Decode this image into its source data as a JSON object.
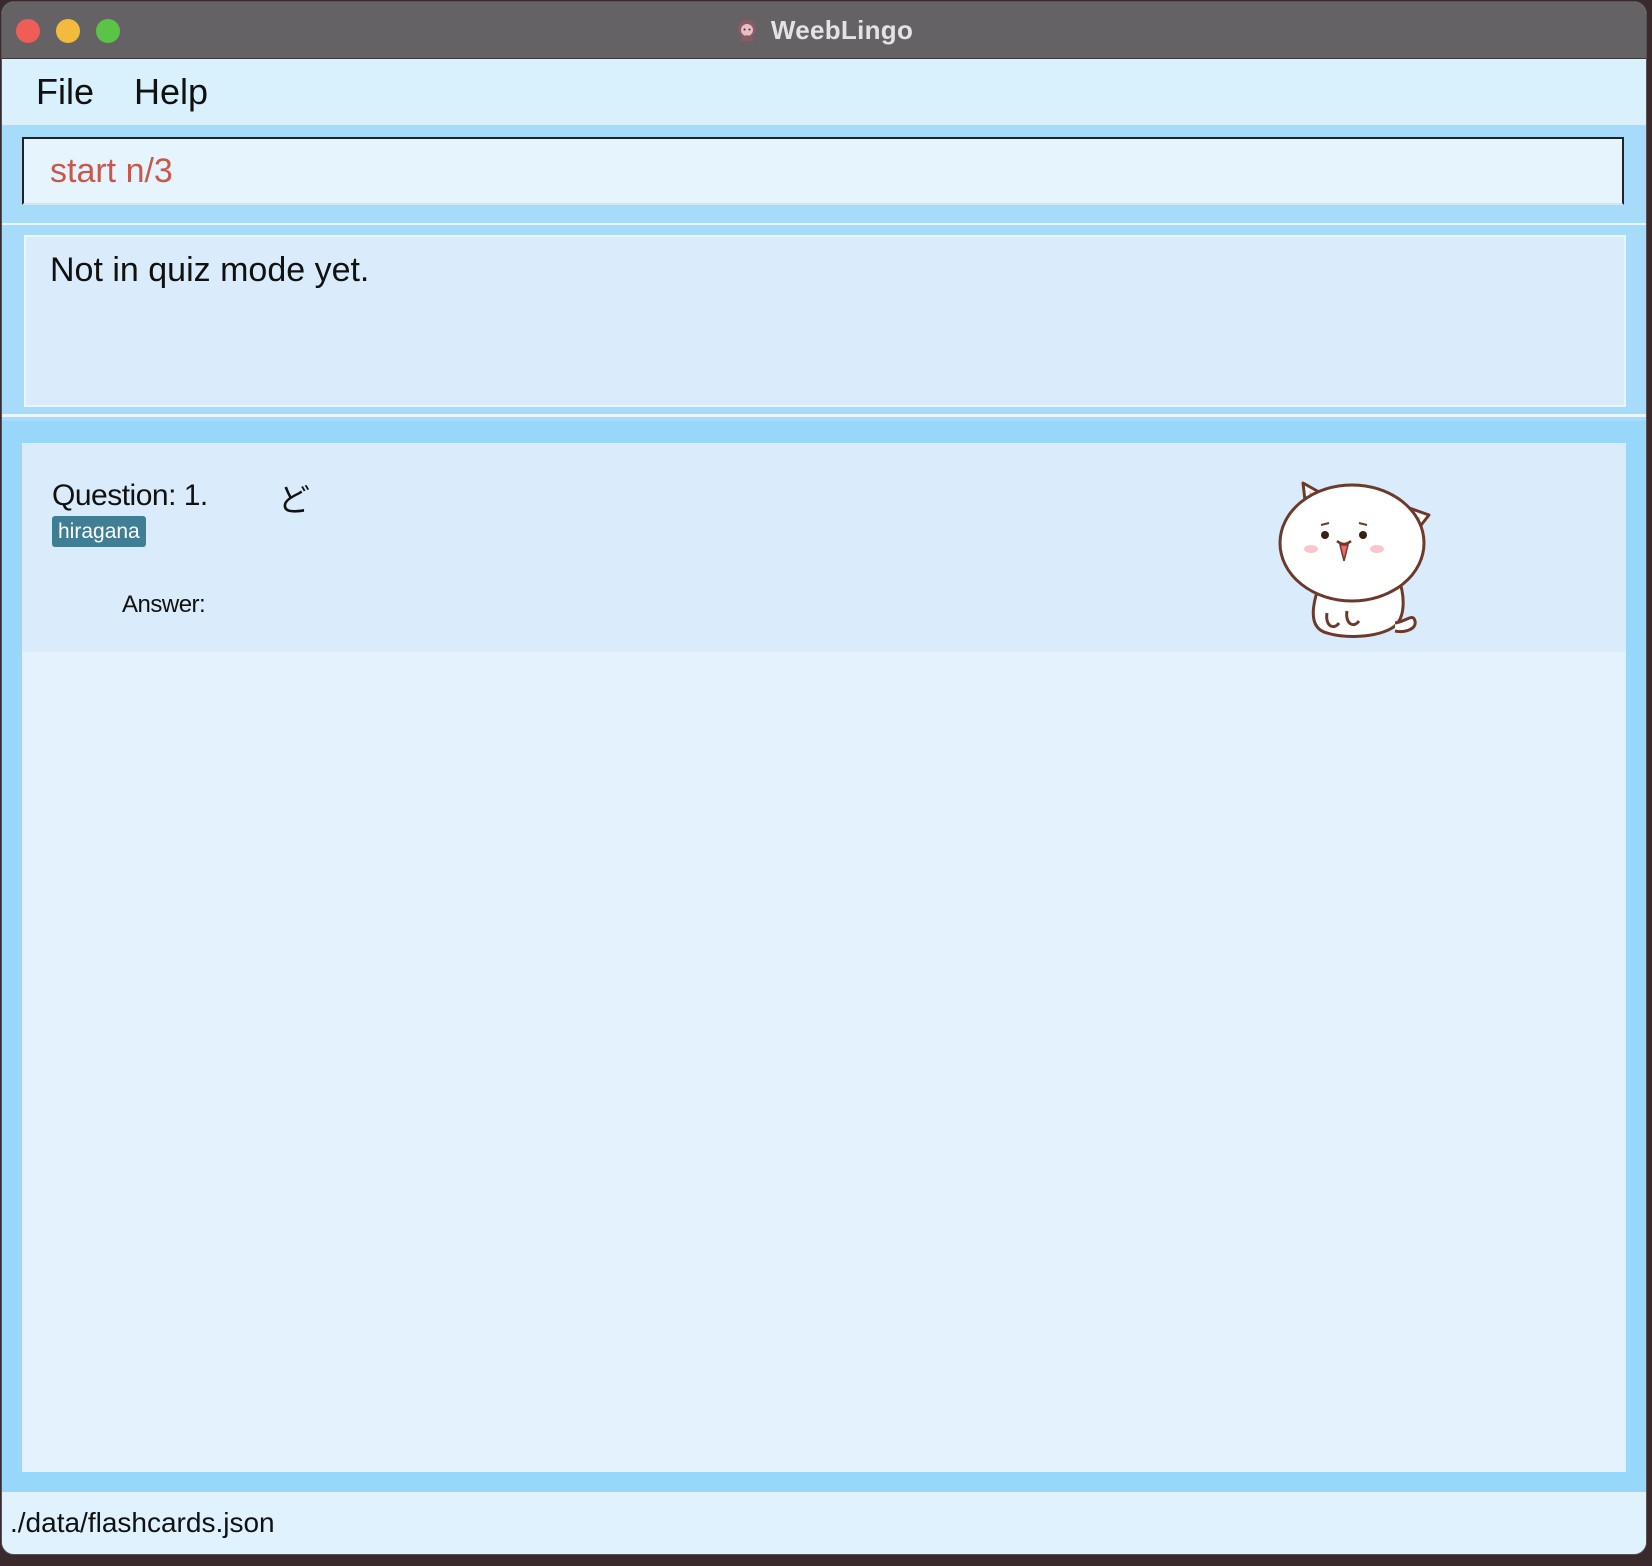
{
  "window": {
    "title": "WeebLingo",
    "app_icon": "app-mascot-icon"
  },
  "menu": {
    "items": [
      {
        "label": "File"
      },
      {
        "label": "Help"
      }
    ]
  },
  "command_box": {
    "value": "start n/3"
  },
  "result_display": {
    "text": "Not in quiz mode yet."
  },
  "flashcard": {
    "question_label": "Question: 1.",
    "question_char": "ど",
    "tag": "hiragana",
    "answer_label": "Answer:",
    "mascot": "cat-mascot-image"
  },
  "status_bar": {
    "file_path": "./data/flashcards.json"
  },
  "colors": {
    "command_text": "#c8584b",
    "tag_bg": "#3f7e94",
    "panel_bg": "#a6dcfa"
  }
}
